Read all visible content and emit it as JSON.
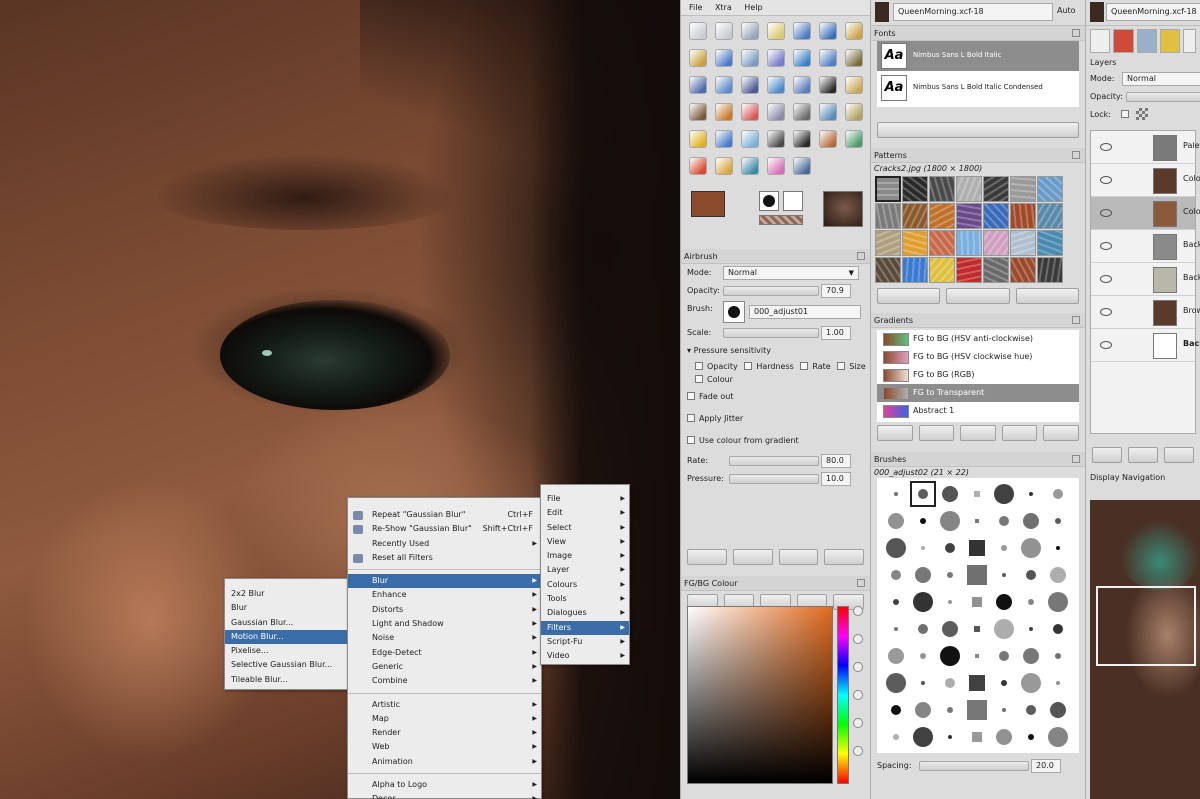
{
  "toolbox": {
    "menu": [
      "File",
      "Xtra",
      "Help"
    ],
    "tool_colors": [
      "#c8cbd0",
      "#c8cbd0",
      "#9aa4b8",
      "#d8c870",
      "#4a78c0",
      "#3a70b8",
      "#c9a445",
      "#c8a040",
      "#4a7ac8",
      "#7a9ac0",
      "#7a7ac8",
      "#3a80c8",
      "#5080c0",
      "#7a6a3a",
      "#4a6aa8",
      "#5a8ac8",
      "#4a5a98",
      "#4a8ac8",
      "#5a7ab8",
      "#2a2a2a",
      "#c8a858",
      "#7a5a3a",
      "#c87a2a",
      "#d85858",
      "#8a8aa8",
      "#6a6a6a",
      "#5a8ab8",
      "#b0a060",
      "#e0b020",
      "#4a7ac8",
      "#7ab0d8",
      "#4a4a4a",
      "#2a2a2a",
      "#b86a3a",
      "#4a9a6a",
      "#d84a30",
      "#d8a840",
      "#3a8aa8",
      "#d870b8",
      "#4a6a98"
    ],
    "fg_color": "#8b4a2b",
    "bg_color": "#ffffff"
  },
  "tool_options": {
    "title": "Airbrush",
    "mode_label": "Mode:",
    "mode_value": "Normal",
    "opacity_label": "Opacity:",
    "opacity_value": "70.9",
    "brush_label": "Brush:",
    "brush_value": "000_adjust01",
    "scale_label": "Scale:",
    "scale_value": "1.00",
    "pressure_label": "Pressure sensitivity",
    "pressure_opts": [
      "Opacity",
      "Hardness",
      "Rate",
      "Size"
    ],
    "colour_label": "Colour",
    "fade_label": "Fade out",
    "jitter_label": "Apply Jitter",
    "gradient_label": "Use colour from gradient",
    "rate_label": "Rate:",
    "rate_value": "80.0",
    "pressure2_label": "Pressure:",
    "pressure2_value": "10.0",
    "fgbg_title": "FG/BG Colour"
  },
  "mid": {
    "image_title": "QueenMorning.xcf-18",
    "auto_label": "Auto",
    "fonts_title": "Fonts",
    "fonts": [
      "Nimbus Sans L Bold Italic",
      "Nimbus Sans L Bold Italic Condensed"
    ],
    "font_glyph": "Aa",
    "patterns_title": "Patterns",
    "pattern_info": "Cracks2.jpg (1800 × 1800)",
    "pattern_colors": [
      "#8a8a8a",
      "#2a2a2a",
      "#4a4a4a",
      "#b0b0b0",
      "#3a3a3a",
      "#9a9a9a",
      "#6a9ac8",
      "#7a7a7a",
      "#8a5a2a",
      "#c0702a",
      "#6a4a8a",
      "#3a6ab8",
      "#a04a2a",
      "#5a8aa8",
      "#b0a080",
      "#e0a030",
      "#c86a4a",
      "#7ab0e0",
      "#d0a0c0",
      "#b0c0d0",
      "#4a8ab0",
      "#5a4a3a",
      "#3a7ad0",
      "#e0c040",
      "#c02a2a",
      "#6a6a6a",
      "#9a4a2a",
      "#3a3a3a"
    ],
    "gradients_title": "Gradients",
    "gradients": [
      {
        "name": "FG to BG (HSV anti-clockwise)",
        "c1": "#8b4a2b",
        "c2": "#60c080"
      },
      {
        "name": "FG to BG (HSV clockwise hue)",
        "c1": "#8b4a2b",
        "c2": "#e0a0c0"
      },
      {
        "name": "FG to BG (RGB)",
        "c1": "#8b4a2b",
        "c2": "#f0e0d8"
      },
      {
        "name": "FG to Transparent",
        "c1": "#8b4a2b",
        "c2": "#b0b0b0"
      },
      {
        "name": "Abstract 1",
        "c1": "#e040a0",
        "c2": "#4060e0"
      }
    ],
    "brushes_title": "Brushes",
    "brush_info": "000_adjust02 (21 × 22)",
    "spacing_label": "Spacing:",
    "spacing_value": "20.0"
  },
  "right": {
    "image_title": "QueenMorning.xcf-18",
    "layers_title": "Layers",
    "mode_label": "Mode:",
    "mode_value": "Normal",
    "opacity_label": "Opacity:",
    "lock_label": "Lock:",
    "layers": [
      {
        "name": "Palette",
        "thumb": "#7a7a7a",
        "selected": false
      },
      {
        "name": "Colour",
        "thumb": "#5a3a2a",
        "selected": false
      },
      {
        "name": "Colour",
        "thumb": "#8a5a3a",
        "selected": true
      },
      {
        "name": "Backgr",
        "thumb": "#8a8a8a",
        "selected": false
      },
      {
        "name": "Backgr",
        "thumb": "#b8b8a8",
        "selected": false
      },
      {
        "name": "Brown",
        "thumb": "#5a3a2a",
        "selected": false
      },
      {
        "name": "Backgr",
        "thumb": "#ffffff",
        "selected": false
      }
    ],
    "nav_title": "Display Navigation"
  },
  "menus": {
    "filters": [
      {
        "label": "Repeat \"Gaussian Blur\"",
        "shortcut": "Ctrl+F",
        "icon": true
      },
      {
        "label": "Re-Show \"Gaussian Blur\"",
        "shortcut": "Shift+Ctrl+F",
        "icon": true
      },
      {
        "label": "Recently Used",
        "arrow": true
      },
      {
        "label": "Reset all Filters",
        "icon": true
      },
      {
        "sep": true
      },
      {
        "label": "Blur",
        "arrow": true,
        "hl": true
      },
      {
        "label": "Enhance",
        "arrow": true
      },
      {
        "label": "Distorts",
        "arrow": true
      },
      {
        "label": "Light and Shadow",
        "arrow": true
      },
      {
        "label": "Noise",
        "arrow": true
      },
      {
        "label": "Edge-Detect",
        "arrow": true
      },
      {
        "label": "Generic",
        "arrow": true
      },
      {
        "label": "Combine",
        "arrow": true
      },
      {
        "sep": true
      },
      {
        "label": "Artistic",
        "arrow": true
      },
      {
        "label": "Map",
        "arrow": true
      },
      {
        "label": "Render",
        "arrow": true
      },
      {
        "label": "Web",
        "arrow": true
      },
      {
        "label": "Animation",
        "arrow": true
      },
      {
        "sep": true
      },
      {
        "label": "Alpha to Logo",
        "arrow": true
      },
      {
        "label": "Decor",
        "arrow": true
      }
    ],
    "blur": [
      {
        "label": "2x2 Blur"
      },
      {
        "label": "Blur"
      },
      {
        "label": "Gaussian Blur..."
      },
      {
        "label": "Motion Blur...",
        "hl": true
      },
      {
        "label": "Pixelise..."
      },
      {
        "label": "Selective Gaussian Blur..."
      },
      {
        "label": "Tileable Blur..."
      }
    ],
    "main": [
      {
        "label": "File",
        "arrow": true
      },
      {
        "label": "Edit",
        "arrow": true
      },
      {
        "label": "Select",
        "arrow": true
      },
      {
        "label": "View",
        "arrow": true
      },
      {
        "label": "Image",
        "arrow": true
      },
      {
        "label": "Layer",
        "arrow": true
      },
      {
        "label": "Colours",
        "arrow": true
      },
      {
        "label": "Tools",
        "arrow": true
      },
      {
        "label": "Dialogues",
        "arrow": true
      },
      {
        "label": "Filters",
        "arrow": true,
        "hl": true
      },
      {
        "label": "Script-Fu",
        "arrow": true
      },
      {
        "label": "Video",
        "arrow": true
      }
    ]
  }
}
